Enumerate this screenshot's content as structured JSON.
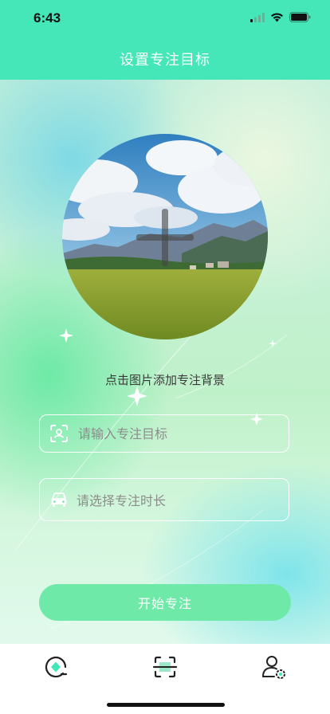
{
  "status_bar": {
    "time": "6:43"
  },
  "nav": {
    "title": "设置专注目标"
  },
  "photo": {
    "hint": "点击图片添加专注背景"
  },
  "form": {
    "goal_placeholder": "请输入专注目标",
    "duration_placeholder": "请选择专注时长"
  },
  "actions": {
    "start_label": "开始专注"
  },
  "tabs": [
    {
      "icon": "focus-home-icon"
    },
    {
      "icon": "scan-icon"
    },
    {
      "icon": "user-settings-icon"
    }
  ],
  "colors": {
    "accent": "#45e7b9",
    "button": "#6fe9a8"
  }
}
